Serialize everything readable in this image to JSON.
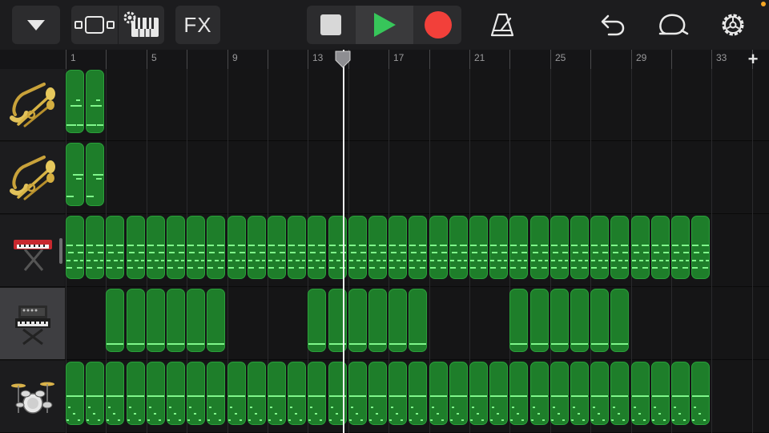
{
  "toolbar": {
    "menu_icon": "caret-down-icon",
    "views_icon": "tracks-view-icon",
    "keys_icon": "keyboard-mixer-icon",
    "fx_label": "FX",
    "stop_icon": "stop-icon",
    "play_icon": "play-icon",
    "record_icon": "record-icon",
    "metronome_icon": "metronome-icon",
    "undo_icon": "undo-icon",
    "loop_icon": "loop-icon",
    "settings_icon": "settings-gear-icon",
    "add_section_label": "+"
  },
  "colors": {
    "play": "#37c65a",
    "record": "#f2403a",
    "region": "#1e7e2a",
    "note": "#7ff58a"
  },
  "ruler": {
    "labels": [
      "1",
      "5",
      "9",
      "13",
      "17",
      "21",
      "25",
      "29",
      "33"
    ],
    "playhead_bar": 14.5
  },
  "tracks": [
    {
      "name": "brass-1",
      "icon": "brass-instruments-icon",
      "selected": false
    },
    {
      "name": "brass-2",
      "icon": "brass-instruments-icon",
      "selected": false
    },
    {
      "name": "keyboard",
      "icon": "keyboard-stand-icon",
      "selected": false
    },
    {
      "name": "synth",
      "icon": "synth-stand-icon",
      "selected": true
    },
    {
      "name": "drums",
      "icon": "drum-kit-icon",
      "selected": false
    }
  ]
}
